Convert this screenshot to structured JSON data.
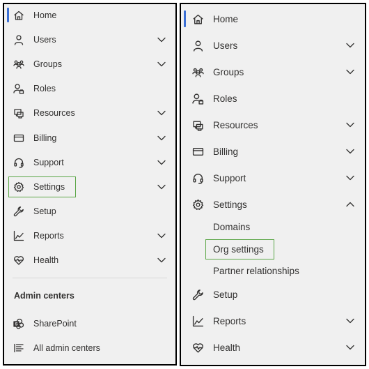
{
  "left": {
    "nav": [
      {
        "label": "Home",
        "icon": "home-icon",
        "chevron": false,
        "active": true
      },
      {
        "label": "Users",
        "icon": "person-icon",
        "chevron": true
      },
      {
        "label": "Groups",
        "icon": "group-icon",
        "chevron": true
      },
      {
        "label": "Roles",
        "icon": "roles-icon",
        "chevron": false
      },
      {
        "label": "Resources",
        "icon": "resources-icon",
        "chevron": true
      },
      {
        "label": "Billing",
        "icon": "billing-card-icon",
        "chevron": true
      },
      {
        "label": "Support",
        "icon": "headset-icon",
        "chevron": true
      },
      {
        "label": "Settings",
        "icon": "gear-icon",
        "chevron": true,
        "highlighted": true
      },
      {
        "label": "Setup",
        "icon": "wrench-icon",
        "chevron": false
      },
      {
        "label": "Reports",
        "icon": "chart-line-icon",
        "chevron": true
      },
      {
        "label": "Health",
        "icon": "heart-pulse-icon",
        "chevron": true
      }
    ],
    "admin_centers": {
      "heading": "Admin centers",
      "items": [
        {
          "label": "SharePoint",
          "icon": "sharepoint-icon"
        },
        {
          "label": "All admin centers",
          "icon": "list-icon"
        }
      ]
    }
  },
  "right": {
    "nav": [
      {
        "label": "Home",
        "icon": "home-icon",
        "chevron": false,
        "active": true
      },
      {
        "label": "Users",
        "icon": "person-icon",
        "chevron": true
      },
      {
        "label": "Groups",
        "icon": "group-icon",
        "chevron": true
      },
      {
        "label": "Roles",
        "icon": "roles-icon",
        "chevron": false
      },
      {
        "label": "Resources",
        "icon": "resources-icon",
        "chevron": true
      },
      {
        "label": "Billing",
        "icon": "billing-card-icon",
        "chevron": true
      },
      {
        "label": "Support",
        "icon": "headset-icon",
        "chevron": true
      },
      {
        "label": "Settings",
        "icon": "gear-icon",
        "chevron": true,
        "expanded": true
      }
    ],
    "settings_children": [
      {
        "label": "Domains"
      },
      {
        "label": "Org settings",
        "highlighted": true
      },
      {
        "label": "Partner relationships"
      }
    ],
    "nav_after": [
      {
        "label": "Setup",
        "icon": "wrench-icon",
        "chevron": false
      },
      {
        "label": "Reports",
        "icon": "chart-line-icon",
        "chevron": true
      },
      {
        "label": "Health",
        "icon": "heart-pulse-icon",
        "chevron": true
      }
    ]
  },
  "colors": {
    "active_indicator": "#3b6fd4",
    "highlight_border": "#5aa646",
    "panel_bg": "#f0f0f0"
  }
}
